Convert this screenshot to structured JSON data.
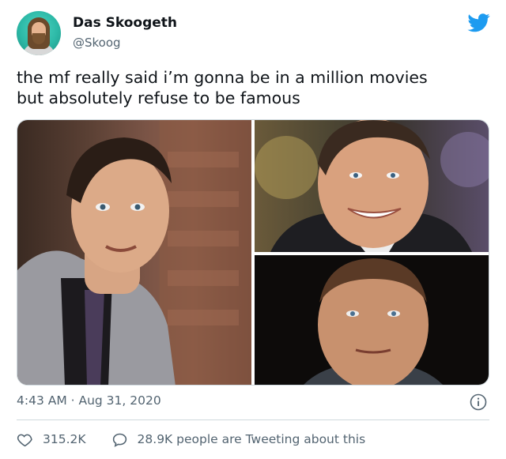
{
  "author": {
    "name": "Das Skoogeth",
    "handle": "@Skoog",
    "avatar_icon": "avatar-photo"
  },
  "brand": {
    "icon": "twitter-bird-icon",
    "color": "#1d9bf0"
  },
  "tweet": {
    "text": "the mf really said i’m gonna be in a million movies\nbut absolutely refuse to be famous"
  },
  "media": {
    "count": 3,
    "photos": [
      "photo-left",
      "photo-top-right",
      "photo-bottom-right"
    ]
  },
  "meta": {
    "time": "4:43 AM",
    "separator": "·",
    "date": "Aug 31, 2020",
    "timestamp_text": "4:43 AM · Aug 31, 2020"
  },
  "actions": {
    "likes": "315.2K",
    "replies_text": "28.9K people are Tweeting about this"
  },
  "colors": {
    "text": "#0f1419",
    "muted": "#536471",
    "border": "#cfd9de"
  }
}
